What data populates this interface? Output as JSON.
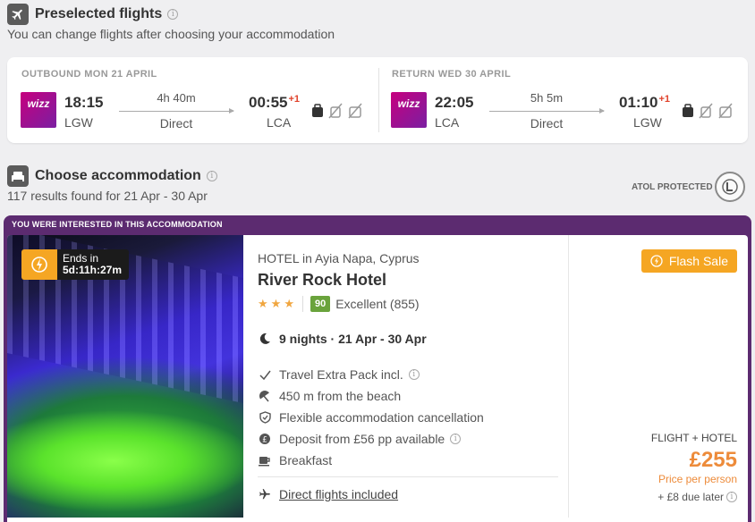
{
  "flights_section": {
    "title": "Preselected flights",
    "subtitle": "You can change flights after choosing your accommodation",
    "outbound": {
      "label": "OUTBOUND MON 21 APRIL",
      "airline": "wizz",
      "dep_time": "18:15",
      "dep_code": "LGW",
      "duration": "4h 40m",
      "stops": "Direct",
      "arr_time": "00:55",
      "arr_plus": "+1",
      "arr_code": "LCA"
    },
    "return": {
      "label": "RETURN WED 30 APRIL",
      "airline": "wizz",
      "dep_time": "22:05",
      "dep_code": "LCA",
      "duration": "5h 5m",
      "stops": "Direct",
      "arr_time": "01:10",
      "arr_plus": "+1",
      "arr_code": "LGW"
    }
  },
  "accommodation_section": {
    "title": "Choose accommodation",
    "results": "117 results found for 21 Apr - 30 Apr",
    "atol_label": "ATOL PROTECTED"
  },
  "hotel_card": {
    "banner": "YOU WERE INTERESTED IN THIS ACCOMMODATION",
    "timer_label": "Ends in",
    "timer_value": "5d:11h:27m",
    "type_location": "HOTEL in Ayia Napa, Cyprus",
    "name": "River Rock Hotel",
    "stars": 3,
    "score": "90",
    "score_text": "Excellent (855)",
    "stay": "9 nights · 21 Apr - 30 Apr",
    "features": [
      "Travel Extra Pack incl.",
      "450 m from the beach",
      "Flexible accommodation cancellation",
      "Deposit from £56 pp available",
      "Breakfast"
    ],
    "direct_flights": "Direct flights included",
    "flash_sale": "Flash Sale",
    "price_label": "FLIGHT + HOTEL",
    "price": "£255",
    "price_note": "Price per person",
    "due_later": "+ £8 due later"
  },
  "colors": {
    "accent_orange": "#f5a623",
    "price_orange": "#ed8b3a",
    "highlight_purple": "#5c2b70",
    "score_green": "#6aa33c",
    "plus_day_red": "#e0412a"
  },
  "icons": [
    "plane-icon",
    "bed-icon",
    "info-icon",
    "bag-icon",
    "no-cabin-bag-icon",
    "no-hold-bag-icon",
    "bolt-icon",
    "moon-icon",
    "check-icon",
    "beach-umbrella-icon",
    "shield-icon",
    "deposit-icon",
    "breakfast-icon",
    "atol-logo-icon"
  ]
}
